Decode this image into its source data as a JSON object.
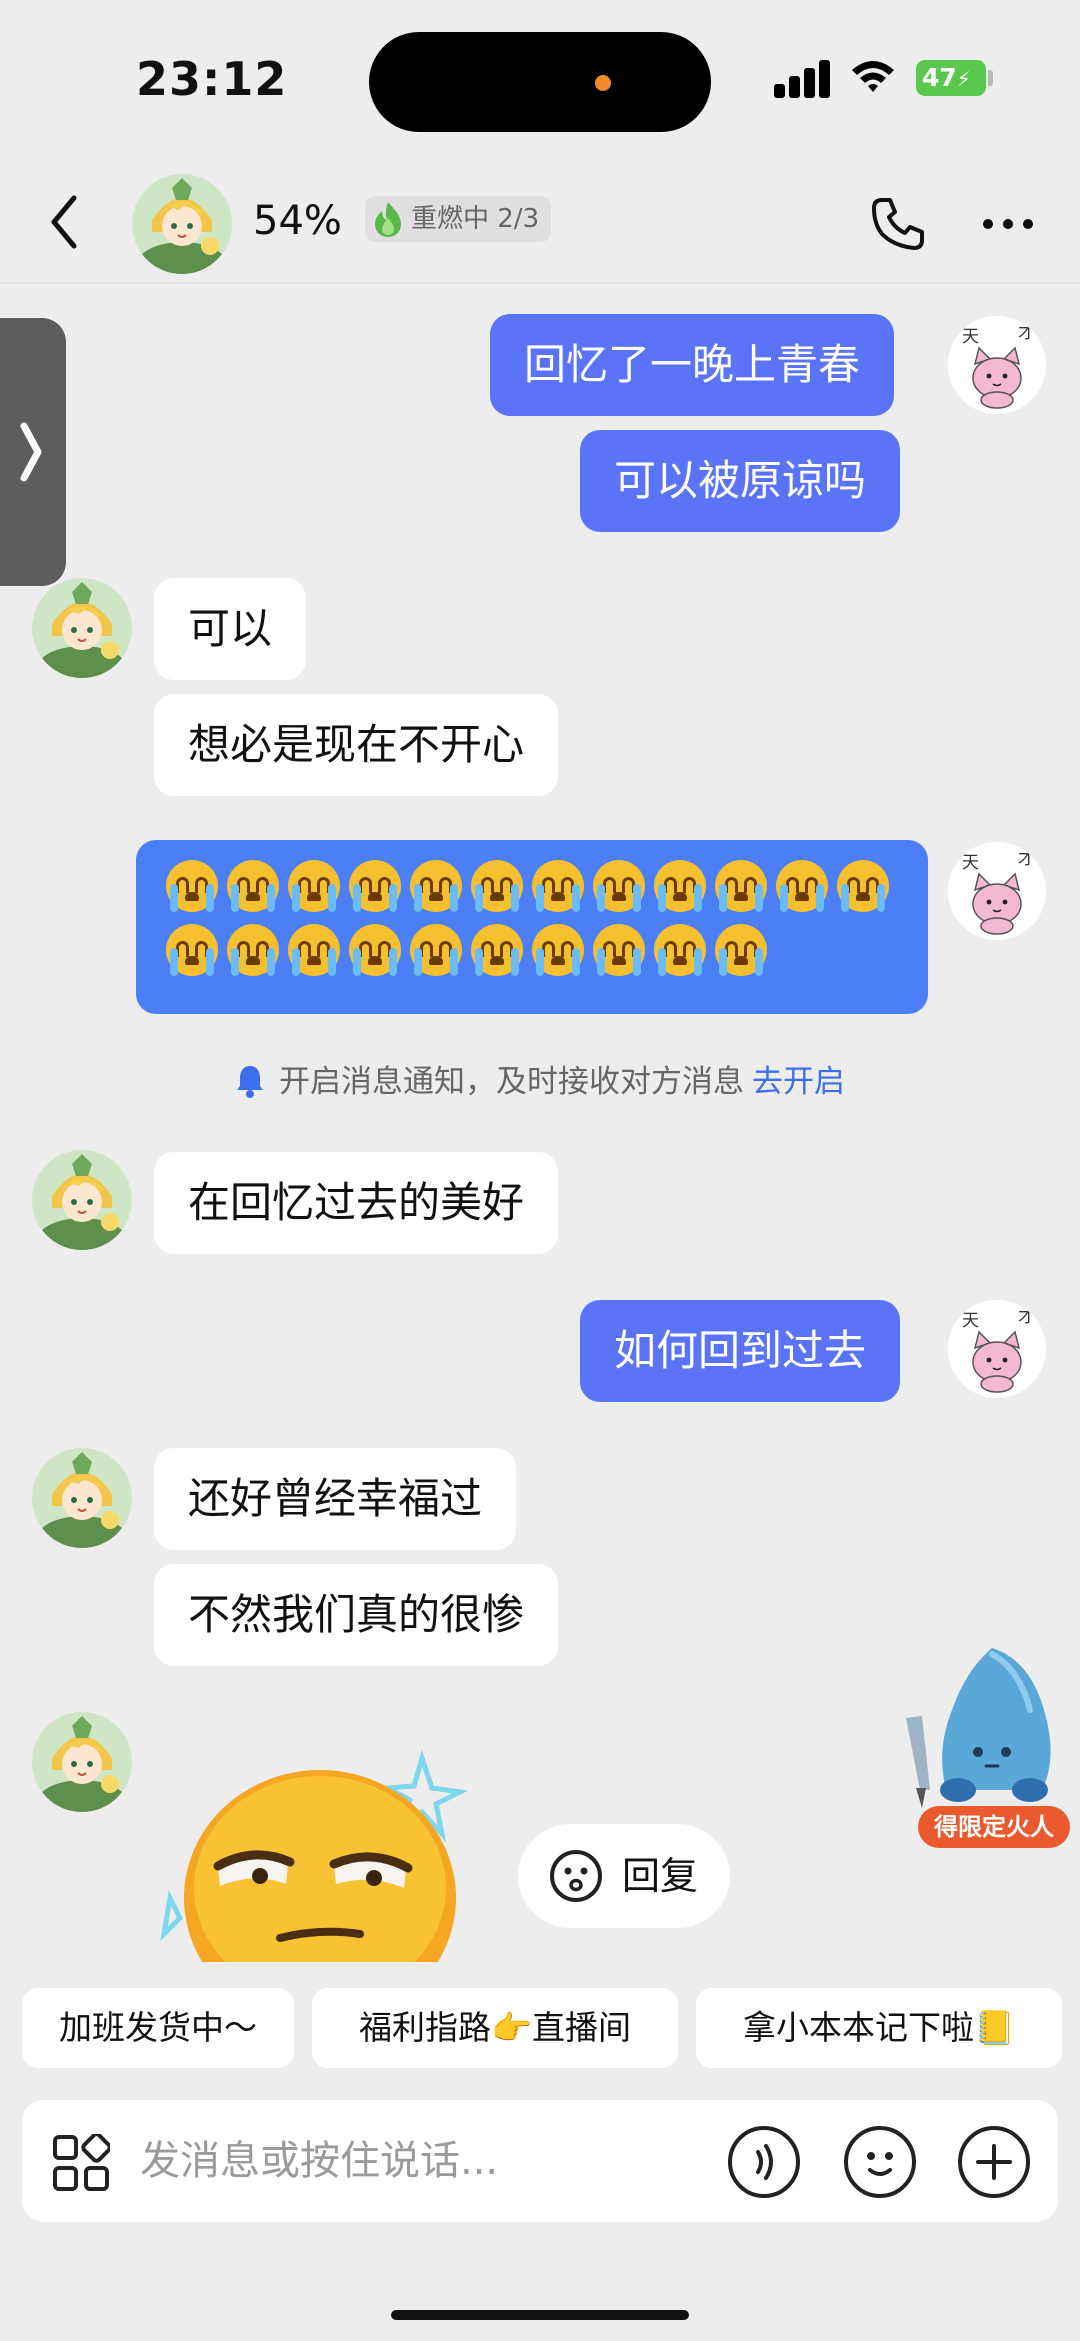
{
  "status_bar": {
    "time": "23:12",
    "battery": "47",
    "icons": [
      "signal-icon",
      "wifi-icon",
      "battery-charging-icon"
    ]
  },
  "header": {
    "percent": "54%",
    "fire_status": "重燃中 2/3",
    "icons": [
      "back-icon",
      "flame-icon",
      "phone-icon",
      "more-icon"
    ]
  },
  "messages": [
    {
      "side": "right",
      "text": "回忆了一晚上青春"
    },
    {
      "side": "right",
      "text": "可以被原谅吗"
    },
    {
      "side": "left",
      "text": "可以"
    },
    {
      "side": "left",
      "text": "想必是现在不开心"
    },
    {
      "side": "right",
      "emoji": "loudly-crying-face",
      "count": 22
    },
    {
      "side": "left",
      "text": "在回忆过去的美好"
    },
    {
      "side": "right",
      "text": "如何回到过去"
    },
    {
      "side": "left",
      "text": "还好曾经幸福过"
    },
    {
      "side": "left",
      "text": "不然我们真的很惨"
    },
    {
      "side": "left",
      "sticker": "smug-sun-sticker"
    }
  ],
  "avatar_right_text": "天才",
  "notice": {
    "text": "开启消息通知，及时接收对方消息",
    "link": "去开启"
  },
  "reply_button": "回复",
  "promo": {
    "label": "得限定火人"
  },
  "quick_replies": [
    "加班发货中～",
    "福利指路👉直播间",
    "拿小本本记下啦📒"
  ],
  "input": {
    "placeholder": "发消息或按住说话...",
    "icons": [
      "apps-icon",
      "voice-icon",
      "emoji-icon",
      "plus-icon"
    ]
  },
  "colors": {
    "bubble_right": "#5b74f7",
    "emoji_bubble": "#4c7ff5",
    "link": "#3d6ef0",
    "promo": "#ea5a2e",
    "background": "#ededed"
  }
}
